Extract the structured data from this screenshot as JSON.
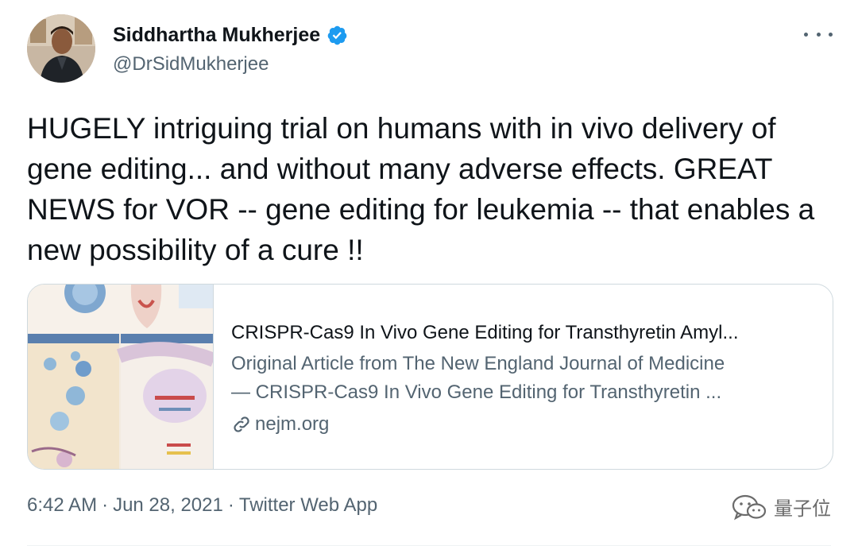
{
  "author": {
    "name": "Siddhartha Mukherjee",
    "handle": "@DrSidMukherjee"
  },
  "tweet": {
    "text": "HUGELY intriguing trial on humans with in vivo delivery of gene editing... and without many adverse effects. GREAT NEWS for VOR -- gene editing for leukemia -- that enables a new possibility of a cure !!"
  },
  "card": {
    "title": "CRISPR-Cas9 In Vivo Gene Editing for Transthyretin Amyl...",
    "description_line1": "Original Article from The New England Journal of Medicine",
    "description_line2": "— CRISPR-Cas9 In Vivo Gene Editing for Transthyretin ...",
    "domain": "nejm.org"
  },
  "meta": {
    "time": "6:42 AM",
    "date": "Jun 28, 2021",
    "source": "Twitter Web App",
    "separator": "·"
  },
  "watermark": {
    "text": "量子位"
  },
  "colors": {
    "verified": "#1d9bf0",
    "secondary_text": "#536471",
    "border": "#cfd9de"
  },
  "icons": {
    "verified": "verified-badge-icon",
    "more": "more-dots-icon",
    "link": "link-icon",
    "watermark": "wechat-icon"
  }
}
